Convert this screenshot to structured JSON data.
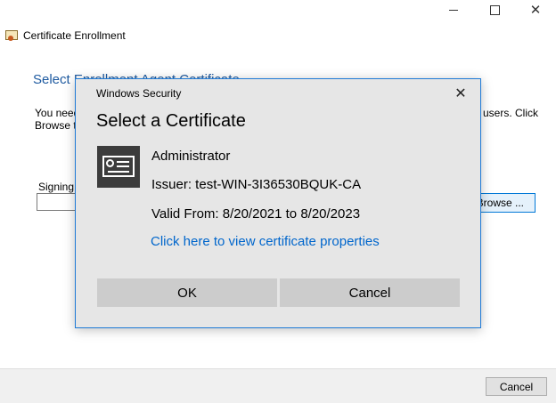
{
  "window": {
    "title": "Certificate Enrollment",
    "close_glyph": "✕"
  },
  "page": {
    "heading": "Select Enrollment Agent Certificate",
    "desc_left": "You need\nBrowse t",
    "desc_right": "users. Click",
    "signing_label": "Signing",
    "browse_label": "Browse ..."
  },
  "footer": {
    "cancel_label": "Cancel"
  },
  "dialog": {
    "title": "Windows Security",
    "heading": "Select a Certificate",
    "close_glyph": "✕",
    "certificate": {
      "name": "Administrator",
      "issuer": "Issuer: test-WIN-3I36530BQUK-CA",
      "valid": "Valid From: 8/20/2021 to 8/20/2023",
      "properties_link": "Click here to view certificate properties"
    },
    "ok_label": "OK",
    "cancel_label": "Cancel"
  },
  "colors": {
    "accent": "#1e7ad6",
    "link": "#0066cc",
    "heading": "#1e5aa0"
  }
}
